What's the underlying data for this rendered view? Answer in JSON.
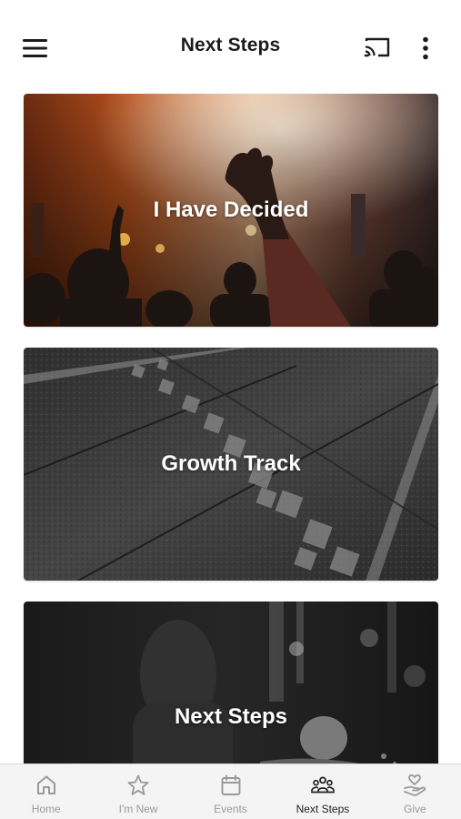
{
  "header": {
    "title": "Next Steps",
    "menu_icon": "hamburger-menu-icon",
    "cast_icon": "cast-icon",
    "more_icon": "more-vertical-icon"
  },
  "cards": [
    {
      "label": "I Have Decided",
      "image": "concert-crowd-raised-hand-photo",
      "tone": "#8a3d1a"
    },
    {
      "label": "Growth Track",
      "image": "stone-pavement-photo",
      "tone": "#3a3a3a"
    },
    {
      "label": "Next Steps",
      "image": "baptism-photo",
      "tone": "#1f1f1f"
    }
  ],
  "tabs": [
    {
      "label": "Home",
      "icon": "home-icon",
      "active": false
    },
    {
      "label": "I'm New",
      "icon": "star-icon",
      "active": false
    },
    {
      "label": "Events",
      "icon": "calendar-icon",
      "active": false
    },
    {
      "label": "Next Steps",
      "icon": "people-group-icon",
      "active": true
    },
    {
      "label": "Give",
      "icon": "heart-hand-icon",
      "active": false
    }
  ],
  "colors": {
    "tab_active": "#1f1f1f",
    "tab_inactive": "#9a9a9a",
    "tabbar_bg": "#f4f4f4"
  }
}
